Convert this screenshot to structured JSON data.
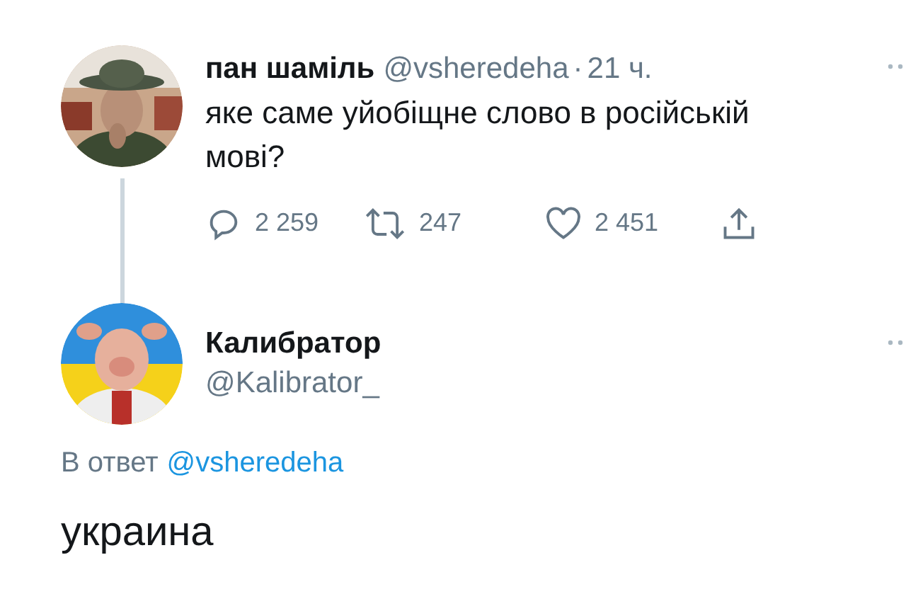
{
  "tweet": {
    "name": "пан шаміль",
    "handle": "@vsheredeha",
    "separator": "·",
    "time": "21 ч.",
    "text": "яке саме уйобіщне слово в російській мові?",
    "actions": [
      {
        "kind": "reply",
        "count": "2 259"
      },
      {
        "kind": "retweet",
        "count": "247"
      },
      {
        "kind": "like",
        "count": "2 451"
      },
      {
        "kind": "share"
      }
    ]
  },
  "reply": {
    "name": "Калибратор",
    "handle": "@Kalibrator_",
    "reply_prefix": "В ответ",
    "reply_to": "@vsheredeha",
    "text": "украина"
  }
}
